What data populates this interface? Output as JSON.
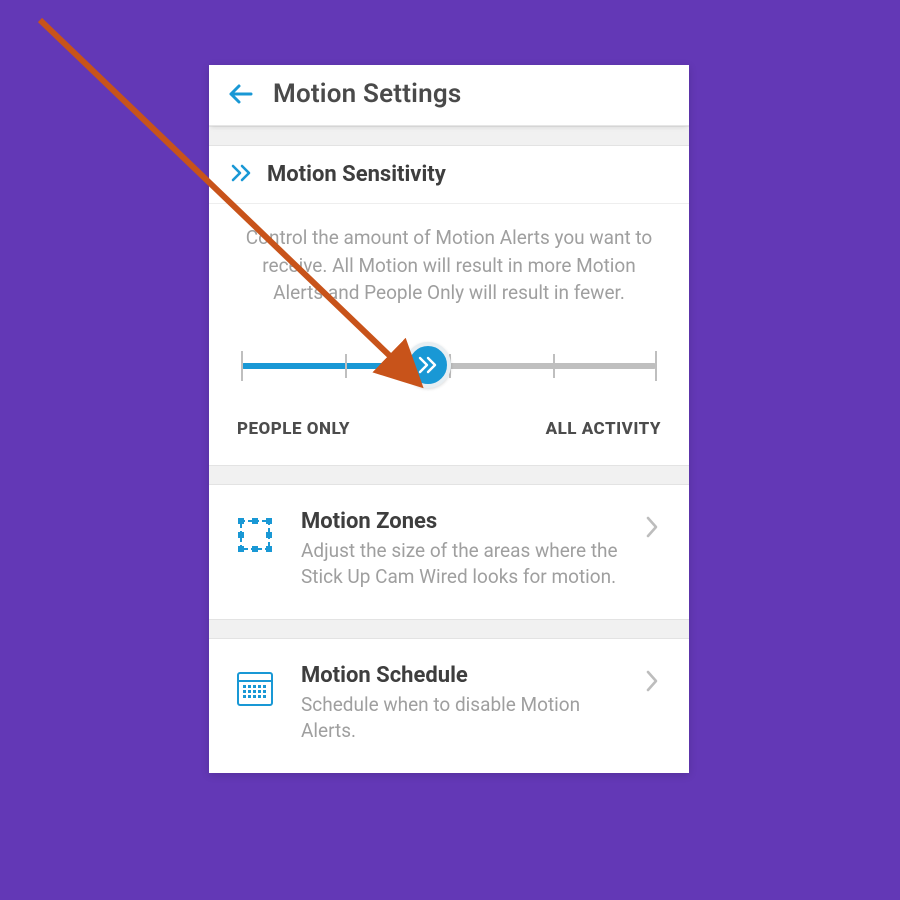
{
  "header": {
    "title": "Motion Settings"
  },
  "sensitivity": {
    "title": "Motion Sensitivity",
    "description": "Control the amount of Motion Alerts you want to receive. All Motion will result in more Motion Alerts and People Only will result in fewer.",
    "min_label": "PEOPLE ONLY",
    "max_label": "ALL ACTIVITY",
    "value_percent": 45
  },
  "rows": {
    "zones": {
      "title": "Motion Zones",
      "subtitle": "Adjust the size of the areas where the Stick Up Cam Wired looks for motion."
    },
    "schedule": {
      "title": "Motion Schedule",
      "subtitle": "Schedule when to disable Motion Alerts."
    }
  },
  "colors": {
    "accent": "#1998d5",
    "background": "#6338b6",
    "annotation_arrow": "#c8531a"
  }
}
